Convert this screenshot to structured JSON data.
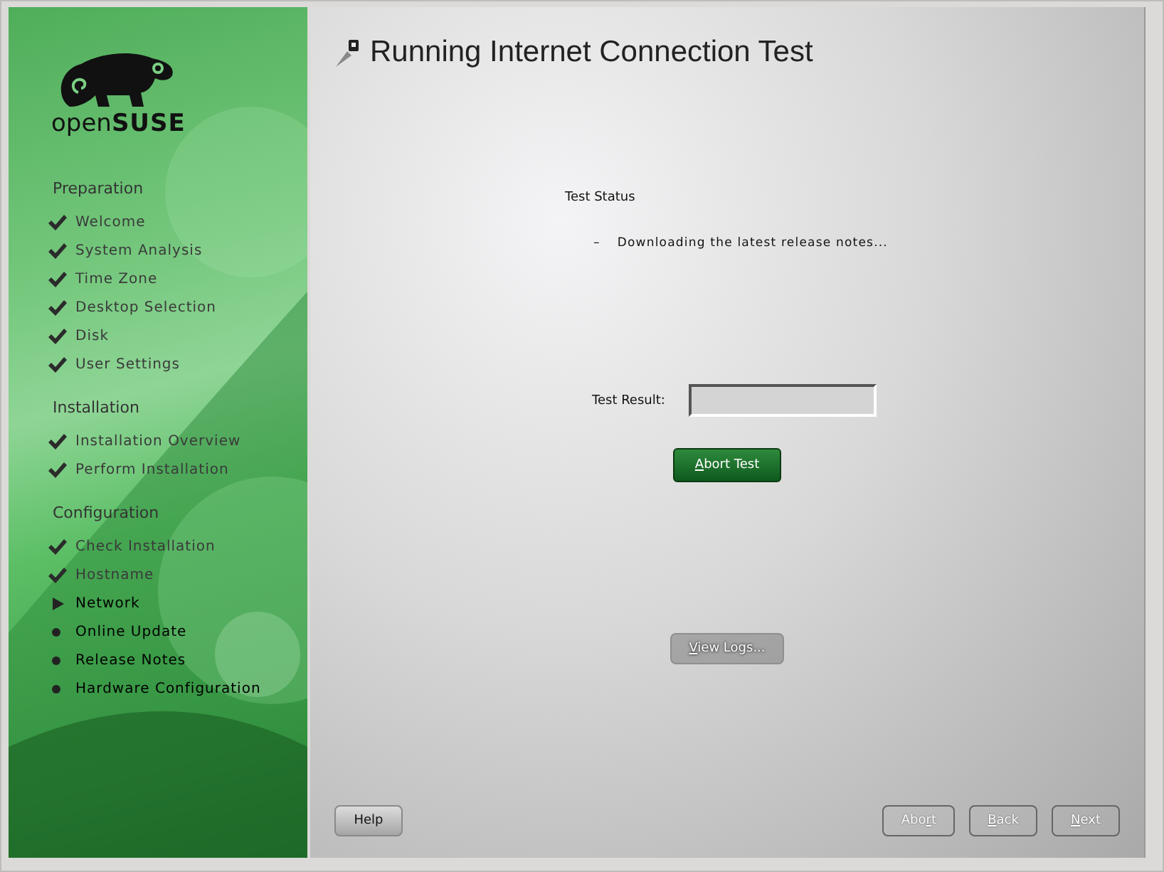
{
  "logo": {
    "wordmark_light": "open",
    "wordmark_bold": "SUSE"
  },
  "sidebar": {
    "sections": [
      {
        "title": "Preparation",
        "items": [
          {
            "label": "Welcome",
            "kind": "done"
          },
          {
            "label": "System Analysis",
            "kind": "done"
          },
          {
            "label": "Time Zone",
            "kind": "done"
          },
          {
            "label": "Desktop Selection",
            "kind": "done"
          },
          {
            "label": "Disk",
            "kind": "done"
          },
          {
            "label": "User Settings",
            "kind": "done"
          }
        ]
      },
      {
        "title": "Installation",
        "items": [
          {
            "label": "Installation Overview",
            "kind": "done"
          },
          {
            "label": "Perform Installation",
            "kind": "done"
          }
        ]
      },
      {
        "title": "Configuration",
        "items": [
          {
            "label": "Check Installation",
            "kind": "done"
          },
          {
            "label": "Hostname",
            "kind": "done"
          },
          {
            "label": "Network",
            "kind": "current"
          },
          {
            "label": "Online Update",
            "kind": "pending"
          },
          {
            "label": "Release Notes",
            "kind": "pending"
          },
          {
            "label": "Hardware Configuration",
            "kind": "pending"
          }
        ]
      }
    ]
  },
  "page": {
    "title": "Running Internet Connection Test",
    "status_heading": "Test Status",
    "status_items": [
      {
        "marker": "–",
        "text": "Downloading the latest release notes..."
      }
    ],
    "result_label": "Test Result:",
    "abort_test_button": {
      "key": "A",
      "after": "bort Test"
    },
    "view_logs_button": {
      "key": "V",
      "after": "iew Logs...",
      "disabled": true
    }
  },
  "footer": {
    "help_button": {
      "after": "Help"
    },
    "buttons": [
      {
        "before": "Abo",
        "key": "r",
        "after": "t"
      },
      {
        "key": "B",
        "after": "ack"
      },
      {
        "key": "N",
        "after": "ext"
      }
    ]
  }
}
